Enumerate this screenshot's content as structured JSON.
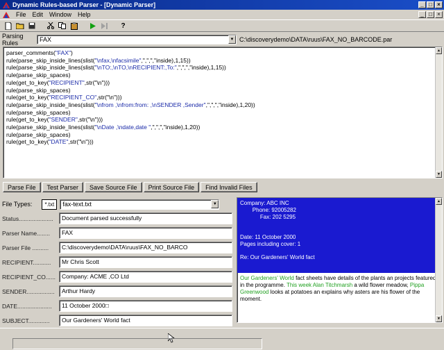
{
  "window": {
    "title": "Dynamic Rules-based Parser - [Dynamic Parser]"
  },
  "menu": [
    "File",
    "Edit",
    "Window",
    "Help"
  ],
  "toolbar": {
    "icons": [
      "new-icon",
      "open-icon",
      "save-icon",
      "cut-icon",
      "copy-icon",
      "paste-icon",
      "run-icon",
      "step-icon",
      "help-icon"
    ]
  },
  "rules": {
    "label": "Parsing Rules",
    "value": "FAX",
    "path": "C:\\discoverydemo\\DATA\\ruus\\FAX_NO_BARCODE.par"
  },
  "code": [
    [
      [
        "parser_comments(",
        ""
      ],
      [
        "\"FAX\"",
        "s"
      ],
      [
        ")",
        ""
      ]
    ],
    [
      [
        "rule(parse_skip_inside_lines(slist(",
        ""
      ],
      [
        "\"\\nfax,\\nfacsimile\"",
        "s"
      ],
      [
        ",\",\",\",\"inside),1,15))",
        ""
      ]
    ],
    [
      [
        "rule(parse_skip_inside_lines(slist(",
        ""
      ],
      [
        "\"\\nTO:,\\nTO,\\nRECIPIENT:,To:\"",
        "s"
      ],
      [
        ",\",\",\",\"inside),1,15))",
        ""
      ]
    ],
    [
      [
        "rule(parse_skip_spaces)",
        ""
      ]
    ],
    [
      [
        "rule(get_to_key(",
        ""
      ],
      [
        "\"RECIPIENT\"",
        "s"
      ],
      [
        ",str(\"\\n\")))",
        ""
      ]
    ],
    [
      [
        "rule(parse_skip_spaces)",
        ""
      ]
    ],
    [
      [
        "rule(get_to_key(",
        ""
      ],
      [
        "\"RECIPIENT_CO\"",
        "s"
      ],
      [
        ",str(\"\\n\")))",
        ""
      ]
    ],
    [
      [
        "rule(parse_skip_inside_lines(slist(",
        ""
      ],
      [
        "\"\\nfrom ,\\nfrom:from: ,\\nSENDER ,Sender\"",
        "s"
      ],
      [
        ",\",\",\",\"inside),1,20))",
        ""
      ]
    ],
    [
      [
        "rule(parse_skip_spaces)",
        ""
      ]
    ],
    [
      [
        "rule(get_to_key(",
        ""
      ],
      [
        "\"SENDER\"",
        "s"
      ],
      [
        ",str(\"\\n\")))",
        ""
      ]
    ],
    [
      [
        "rule(parse_skip_inside_lines(slist(",
        ""
      ],
      [
        "\"\\nDate ,\\ndate,date \"",
        "s"
      ],
      [
        ",\",\",\",\"inside),1,20))",
        ""
      ]
    ],
    [
      [
        "rule(parse_skip_spaces)",
        ""
      ]
    ],
    [
      [
        "rule(get_to_key(",
        ""
      ],
      [
        "\"DATE\"",
        "s"
      ],
      [
        ",str(\"\\n\")))",
        ""
      ]
    ]
  ],
  "buttons": [
    "Parse File",
    "Test Parser",
    "Save Source File",
    "Print Source File",
    "Find Invalid Files"
  ],
  "filetypes": {
    "label": "File Types:",
    "ext": "*.txt",
    "value": "fax-text.txt"
  },
  "fields": [
    {
      "label": "Status.....................",
      "value": "Document parsed successfully"
    },
    {
      "label": "Parser Name........",
      "value": "FAX"
    },
    {
      "label": "Parser File ..........",
      "value": "C:\\discoverydemo\\DATA\\ruus\\FAX_NO_BARCO"
    },
    {
      "label": "RECIPIENT...........",
      "value": "Mr Chris Scott"
    },
    {
      "label": "RECIPIENT_CO......",
      "value": "Company: ACME ,CO Ltd"
    },
    {
      "label": "SENDER.................",
      "value": "Arthur Hardy"
    },
    {
      "label": "DATE.....................",
      "value": "11 October 2000□"
    },
    {
      "label": "SUBJECT.............",
      "value": "Our Gardeners' World fact"
    }
  ],
  "preview": {
    "selected": [
      "Company: ABC INC",
      "        Phone: 92005282",
      "             Fax: 202 5295",
      "",
      "",
      "Date: 11 October 2000",
      "Pages including cover: 1",
      "",
      "Re: Our Gardeners' World fact"
    ],
    "body_a_green": "Our Gardeners' World",
    "body_a": " fact sheets have details of the plants an projects featured in the programme.",
    "body_b_green": "This week Alan Titchmarsh",
    "body_b": " a wild flower meadow, ",
    "body_c_green": "Pippa Greenwood",
    "body_c": " looks at potatoes an explains why asters are his flower of the moment."
  }
}
